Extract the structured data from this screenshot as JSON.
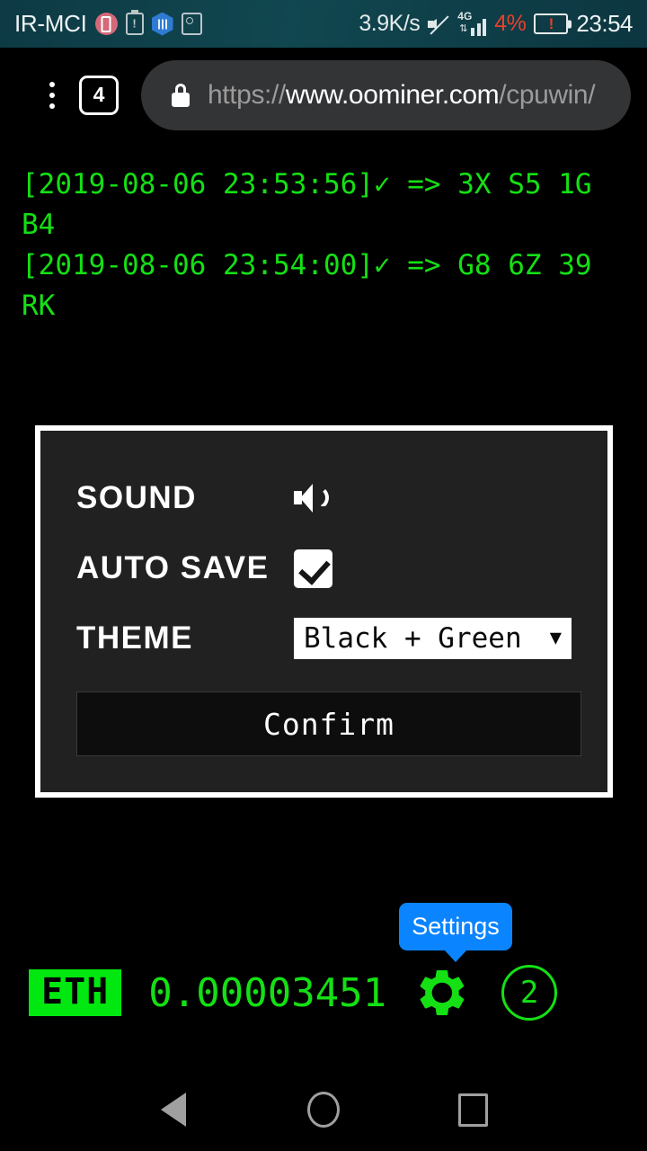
{
  "status_bar": {
    "carrier": "IR-MCI",
    "icons": [
      "sim-card-icon",
      "battery-warning-icon",
      "hexagon-app-icon",
      "photo-gallery-icon"
    ],
    "network_speed": "3.9K/s",
    "mute_icon": "mute-icon",
    "network_type": "4G",
    "battery_percent": "4%",
    "battery_icon_symbol": "!",
    "clock": "23:54",
    "background_color": "#114750"
  },
  "browser": {
    "menu_icon": "overflow-menu-icon",
    "tab_count": "4",
    "lock_icon": "lock-icon",
    "url_scheme": "https://",
    "url_host": "www.oominer.com",
    "url_path": "/cpuwin/"
  },
  "terminal": {
    "text_color": "#14e014",
    "lines": [
      "[2019-08-06 23:53:56]✓ => 3X S5 1G B4",
      "[2019-08-06 23:54:00]✓ => G8 6Z 39 RK"
    ]
  },
  "dialog": {
    "sound": {
      "label": "SOUND",
      "icon": "speaker-on-icon"
    },
    "auto_save": {
      "label": "AUTO SAVE",
      "checked": true
    },
    "theme": {
      "label": "THEME",
      "selected": "Black + Green",
      "caret": "▼",
      "options": [
        "Black + Green"
      ]
    },
    "confirm_label": "Confirm",
    "border_color": "#ffffff",
    "background_color": "#212121"
  },
  "tooltip": {
    "label": "Settings",
    "color": "#0a84ff"
  },
  "bottom_bar": {
    "currency": "ETH",
    "amount": "0.00003451",
    "gear_icon": "gear-icon",
    "counter": "2",
    "accent_color": "#14e014"
  },
  "nav_bar": {
    "back": "back-triangle-icon",
    "home": "home-circle-icon",
    "recents": "recents-square-icon"
  }
}
